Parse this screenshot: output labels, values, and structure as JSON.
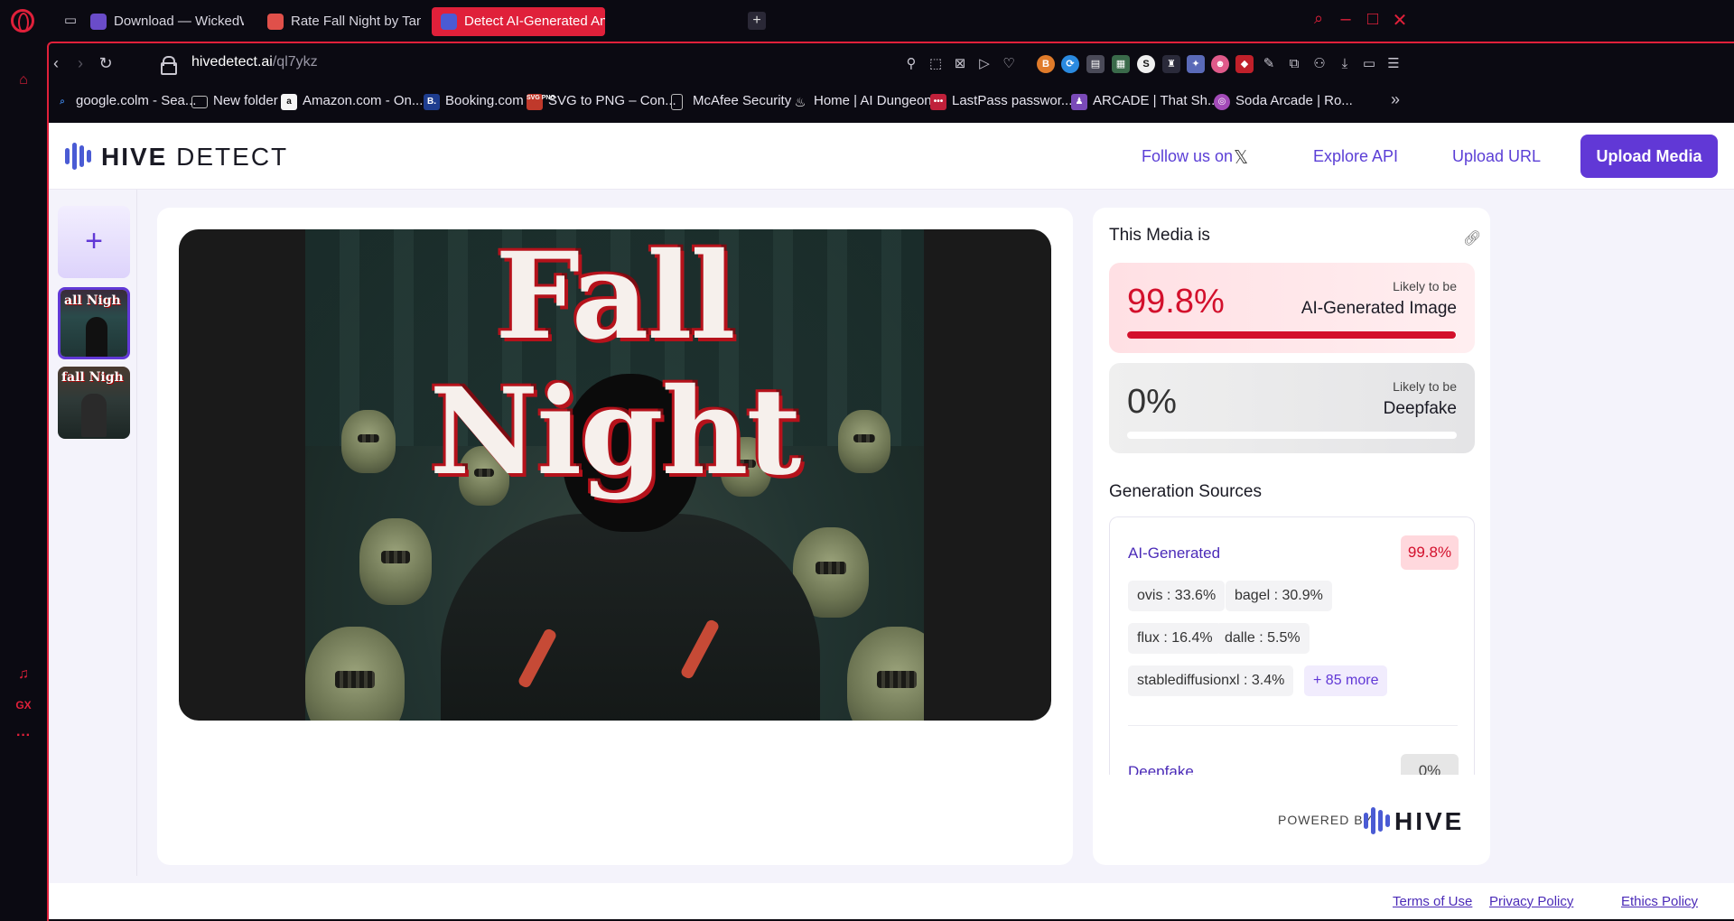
{
  "tabs": [
    {
      "label": "Download — WickedWhim",
      "favicon_color": "#6a4cc9"
    },
    {
      "label": "Rate Fall Night by TanaFO",
      "favicon_color": "#e0504a"
    },
    {
      "label": "Detect AI-Generated And D",
      "favicon_color": "#4a5bd4",
      "active": true
    }
  ],
  "address": {
    "host": "hivedetect.ai",
    "path": "/ql7ykz"
  },
  "bookmarks": [
    {
      "label": "google.colm - Sea...",
      "icon": "search-icon",
      "color": "#3a7bd5"
    },
    {
      "label": "New folder",
      "icon": "folder-icon",
      "color": "transparent"
    },
    {
      "label": "Amazon.com - On...",
      "icon": "amazon-icon",
      "color": "#f5f5f5"
    },
    {
      "label": "Booking.com",
      "icon": "booking-icon",
      "color": "#1e3d8f"
    },
    {
      "label": "SVG to PNG – Con...",
      "icon": "svg-png-icon",
      "color": "#c0392b"
    },
    {
      "label": "McAfee Security",
      "icon": "page-icon",
      "color": "transparent"
    },
    {
      "label": "Home | AI Dungeon",
      "icon": "flame-icon",
      "color": "transparent"
    },
    {
      "label": "LastPass passwor...",
      "icon": "lastpass-icon",
      "color": "#c0203a"
    },
    {
      "label": "ARCADE | That Sh...",
      "icon": "arcade-icon",
      "color": "#7a4ab8"
    },
    {
      "label": "Soda Arcade | Ro...",
      "icon": "soda-icon",
      "color": "#a34ab8"
    }
  ],
  "header": {
    "logo_bold": "HIVE",
    "logo_light": " DETECT",
    "follow_label": "Follow us on",
    "explore_api": "Explore API",
    "upload_url": "Upload URL",
    "upload_media": "Upload Media"
  },
  "artwork": {
    "title": "Fall Night"
  },
  "thumbnails": [
    {
      "caption": "all Nigh"
    },
    {
      "caption": "fall Nigh"
    }
  ],
  "result": {
    "title": "This Media is",
    "ai": {
      "percent": "99.8%",
      "fraction": 0.998,
      "likely": "Likely to be",
      "kind": "AI-Generated Image",
      "color": "#d3102c"
    },
    "deepfake": {
      "percent": "0%",
      "fraction": 0,
      "likely": "Likely to be",
      "kind": "Deepfake"
    },
    "generation_title": "Generation Sources",
    "ai_generated": {
      "label": "AI-Generated",
      "percent": "99.8%",
      "sources": [
        {
          "name": "ovis :",
          "value": "33.6%"
        },
        {
          "name": "bagel :",
          "value": "30.9%"
        },
        {
          "name": "flux :",
          "value": "16.4%"
        },
        {
          "name": "dalle :",
          "value": "5.5%"
        },
        {
          "name": "stablediffusionxl :",
          "value": "3.4%"
        }
      ],
      "more": "+ 85 more"
    },
    "deepfake_section": {
      "label": "Deepfake",
      "percent": "0%"
    },
    "powered_by": "POWERED BY",
    "hive": "HIVE"
  },
  "footer": {
    "terms": "Terms of Use",
    "privacy": "Privacy Policy",
    "ethics": "Ethics Policy"
  }
}
